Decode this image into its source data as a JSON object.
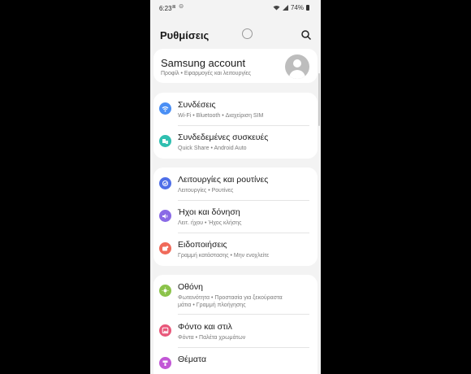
{
  "status_bar": {
    "time": "6:23",
    "indicators": "⧈ ⊖",
    "battery": "74%"
  },
  "header": {
    "title": "Ρυθμίσεις"
  },
  "account": {
    "name": "Samsung account",
    "sub": "Προφίλ • Εφαρμογές και λειτουργίες"
  },
  "groups": [
    {
      "items": [
        {
          "icon": "wifi-icon",
          "color": "#4a8ff5",
          "label": "Συνδέσεις",
          "sub": "Wi-Fi • Bluetooth • Διαχείριση SIM"
        },
        {
          "icon": "connected-devices-icon",
          "color": "#2fbfb0",
          "label": "Συνδεδεμένες συσκευές",
          "sub": "Quick Share • Android Auto"
        }
      ]
    },
    {
      "items": [
        {
          "icon": "modes-routines-icon",
          "color": "#4f6fe8",
          "label": "Λειτουργίες και ρουτίνες",
          "sub": "Λειτουργίες • Ρουτίνες"
        },
        {
          "icon": "sound-icon",
          "color": "#8a6ae6",
          "label": "Ήχοι και δόνηση",
          "sub": "Λειτ. ήχου • Ήχος κλήσης"
        },
        {
          "icon": "notifications-icon",
          "color": "#f06a5a",
          "label": "Ειδοποιήσεις",
          "sub": "Γραμμή κατάστασης • Μην ενοχλείτε"
        }
      ]
    },
    {
      "items": [
        {
          "icon": "display-icon",
          "color": "#8bc34a",
          "label": "Οθόνη",
          "sub": "Φωτεινότητα • Προστασία για ξεκούραστα",
          "sub2": "μάτια • Γραμμή πλοήγησης"
        },
        {
          "icon": "wallpaper-icon",
          "color": "#e8577a",
          "label": "Φόντο και στιλ",
          "sub": "Φόντα • Παλέτα χρωμάτων"
        },
        {
          "icon": "themes-icon",
          "color": "#c257d6",
          "label": "Θέματα",
          "sub": ""
        }
      ]
    }
  ]
}
